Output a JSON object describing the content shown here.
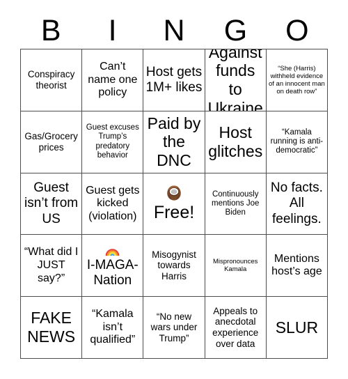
{
  "header": {
    "letters": [
      "B",
      "I",
      "N",
      "G",
      "O"
    ]
  },
  "grid": {
    "rows": [
      [
        {
          "text": "Conspiracy theorist",
          "size": "md"
        },
        {
          "text": "Can’t name one policy",
          "size": "lg"
        },
        {
          "text": "Host gets 1M+ likes",
          "size": "xl"
        },
        {
          "text": "Against funds to Ukraine",
          "size": "xxl"
        },
        {
          "text": "“She (Harris) withheld evidence of an innocent man on death row”",
          "size": "xs"
        }
      ],
      [
        {
          "text": "Gas/Grocery prices",
          "size": "md"
        },
        {
          "text": "Guest excuses Trump’s predatory behavior",
          "size": "sm"
        },
        {
          "text": "Paid by the DNC",
          "size": "xxl"
        },
        {
          "text": "Host glitches",
          "size": "xxl"
        },
        {
          "text": "“Kamala running is anti-democratic”",
          "size": "sm"
        }
      ],
      [
        {
          "text": "Guest isn’t from US",
          "size": "xl"
        },
        {
          "text": "Guest gets kicked (violation)",
          "size": "lg"
        },
        {
          "text": "Free!",
          "size": "free",
          "icon": "coconut-emoji"
        },
        {
          "text": "Continuously mentions Joe Biden",
          "size": "sm"
        },
        {
          "text": "No facts. All feelings.",
          "size": "xl"
        }
      ],
      [
        {
          "text": "“What did I JUST say?”",
          "size": "lg"
        },
        {
          "text": "I-MAGA-Nation",
          "size": "xl",
          "inline_icon": "rainbow-emoji"
        },
        {
          "text": "Misogynist towards Harris",
          "size": "md"
        },
        {
          "text": "Mispronounces Kamala",
          "size": "xs"
        },
        {
          "text": "Mentions host’s age",
          "size": "lg"
        }
      ],
      [
        {
          "text": "FAKE NEWS",
          "size": "xxl"
        },
        {
          "text": "“Kamala isn’t qualified”",
          "size": "lg"
        },
        {
          "text": "“No new wars under Trump”",
          "size": "md"
        },
        {
          "text": "Appeals to anecdotal experience over data",
          "size": "md"
        },
        {
          "text": "SLUR",
          "size": "xxl"
        }
      ]
    ]
  },
  "colors": {
    "border": "#4d4d4d",
    "text": "#000000",
    "background": "#ffffff"
  }
}
